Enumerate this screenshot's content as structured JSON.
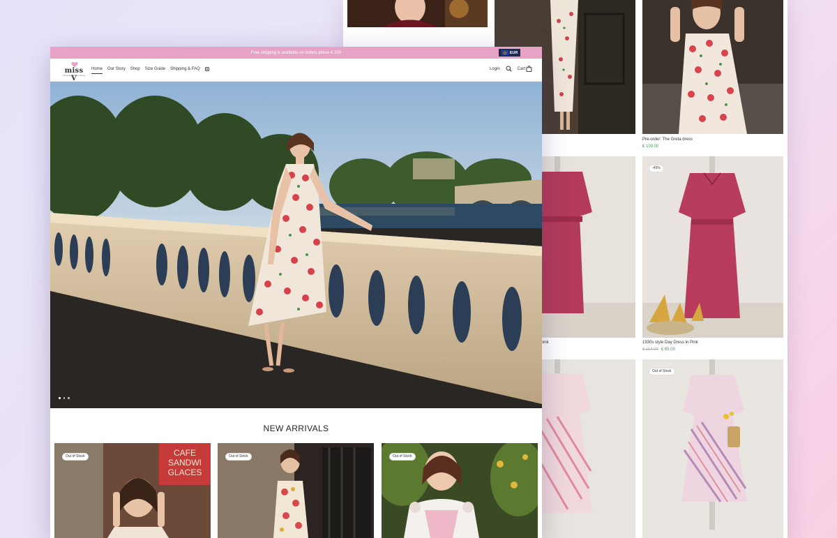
{
  "announcement": {
    "text": "Free shipping is available on orders above € 200"
  },
  "currency": {
    "label": "EUR"
  },
  "brand": {
    "name": "miss V",
    "tagline": "reinventing vintage clothing"
  },
  "nav": {
    "items": [
      "Home",
      "Our Story",
      "Shop",
      "Size Guide",
      "Shipping & FAQ"
    ],
    "active": "Home"
  },
  "header": {
    "login": "Login",
    "cart": "Cart"
  },
  "hero": {
    "slides": 3,
    "active_slide": 1
  },
  "new_arrivals": {
    "title": "NEW ARRIVALS",
    "items": [
      {
        "badge": "Out of Stock"
      },
      {
        "badge": "Out of Stock"
      },
      {
        "badge": "Out of Stock"
      }
    ]
  },
  "grid": {
    "products": [
      {
        "title": "Pre-order: The Greta dress",
        "price": "€ 109.00"
      },
      {
        "title": "k pink",
        "price": ""
      },
      {
        "title": "1930s style Day Dress in Pink",
        "old_price": "€ 114.00",
        "price": "€ 65.00",
        "badge": "-45%"
      },
      {
        "badge": "Out of Stock"
      }
    ]
  },
  "colors": {
    "accent_pink": "#e7a3c6",
    "price_green": "#3aa84a"
  }
}
